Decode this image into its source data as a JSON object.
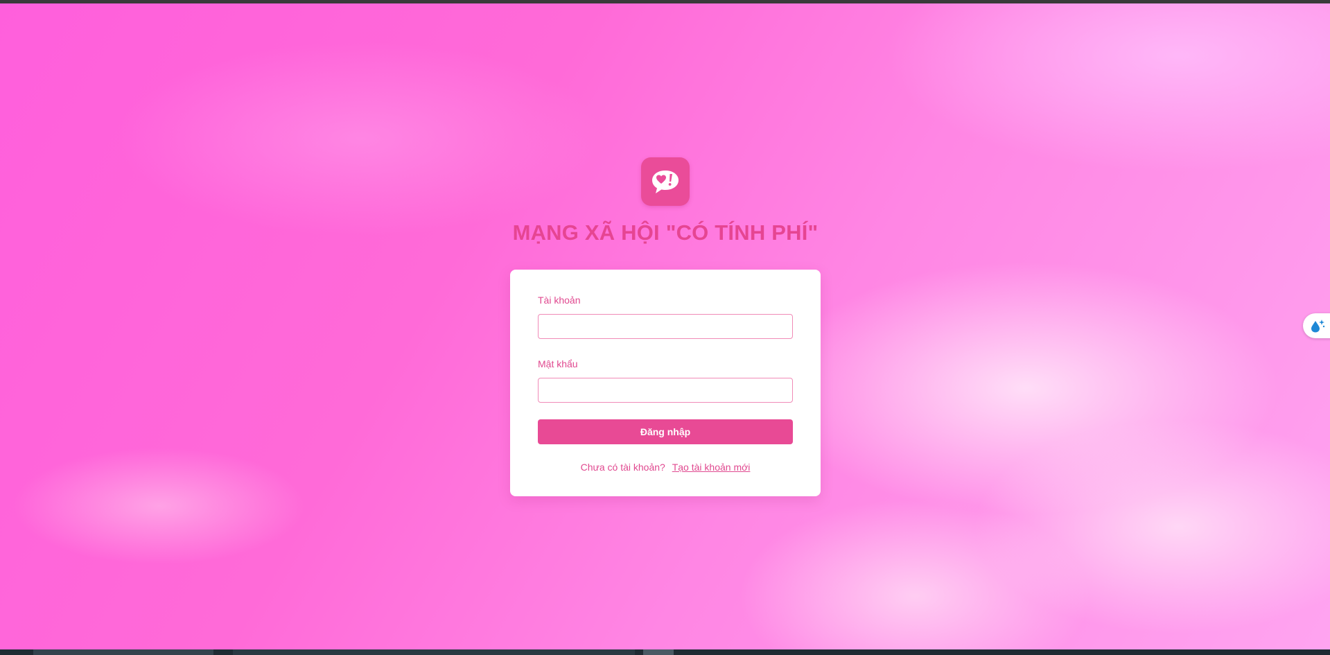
{
  "app": {
    "title": "MẠNG XÃ HỘI \"CÓ TÍNH PHÍ\"",
    "logo_icon": "heart-speech-bubble-icon",
    "accent_color": "#e84a95"
  },
  "login_form": {
    "username_label": "Tài khoản",
    "username_value": "",
    "password_label": "Mật khẩu",
    "password_value": "",
    "submit_label": "Đăng nhập",
    "signup_prompt": "Chưa có tài khoản?",
    "signup_link": "Tạo tài khoản mới"
  },
  "side_widget": {
    "icon": "water-drop-sparkle-icon"
  }
}
